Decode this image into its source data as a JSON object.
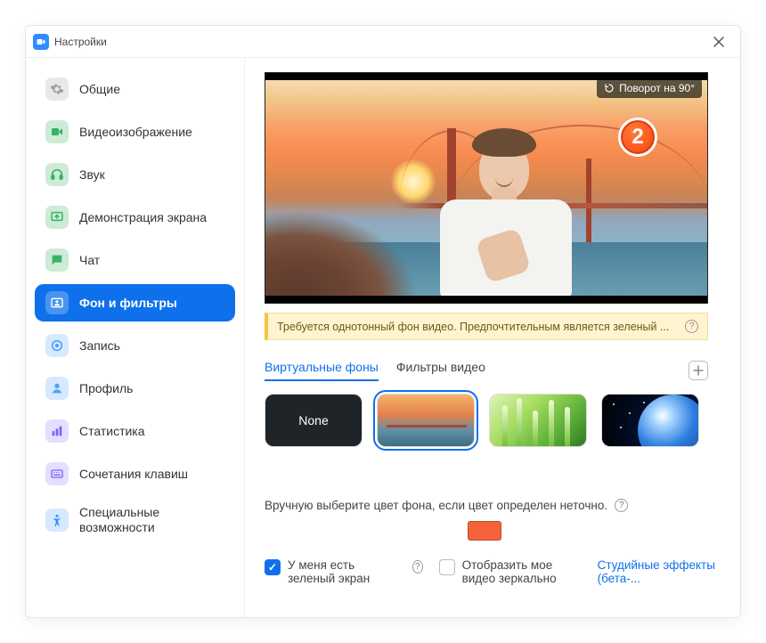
{
  "window": {
    "title": "Настройки"
  },
  "sidebar": {
    "items": [
      {
        "label": "Общие"
      },
      {
        "label": "Видеоизображение"
      },
      {
        "label": "Звук"
      },
      {
        "label": "Демонстрация экрана"
      },
      {
        "label": "Чат"
      },
      {
        "label": "Фон и фильтры"
      },
      {
        "label": "Запись"
      },
      {
        "label": "Профиль"
      },
      {
        "label": "Статистика"
      },
      {
        "label": "Сочетания клавиш"
      },
      {
        "label": "Специальные возможности"
      }
    ]
  },
  "preview": {
    "rotate_label": "Поворот на 90°",
    "badge": "2"
  },
  "warning": {
    "text": "Требуется однотонный фон видео. Предпочтительным является зеленый ..."
  },
  "tabs": {
    "virtual_backgrounds": "Виртуальные фоны",
    "video_filters": "Фильтры видео"
  },
  "thumbs": {
    "none_label": "None",
    "items": [
      {
        "name": "none"
      },
      {
        "name": "golden-gate",
        "selected": true
      },
      {
        "name": "grass"
      },
      {
        "name": "earth"
      }
    ]
  },
  "manual": {
    "text": "Вручную выберите цвет фона, если цвет определен неточно.",
    "swatch_color": "#f6623a"
  },
  "checks": {
    "green_screen_label": "У меня есть зеленый экран",
    "green_screen_checked": true,
    "mirror_label": "Отобразить мое видео зеркально",
    "mirror_checked": false,
    "studio_link": "Студийные эффекты (бета-..."
  }
}
